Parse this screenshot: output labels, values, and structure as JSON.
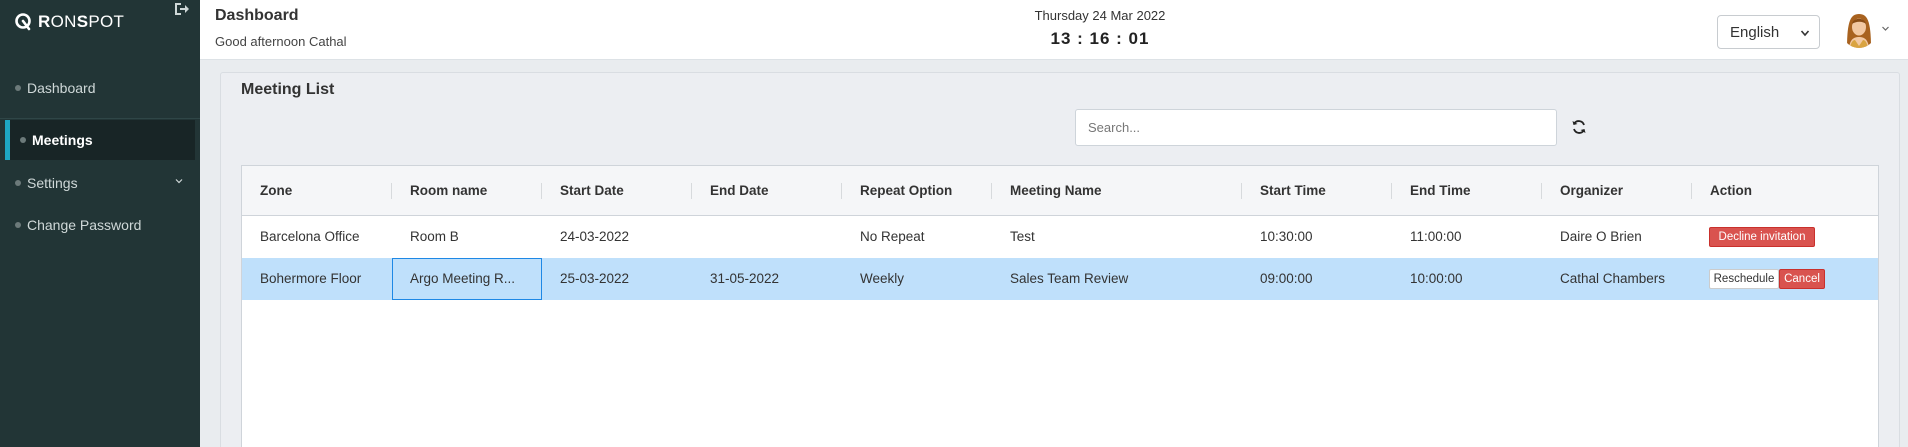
{
  "sidebar": {
    "logo": {
      "prefix": "R",
      "mid1": "ON",
      "mid2": "S",
      "rest": "POT"
    },
    "items": [
      {
        "label": "Dashboard"
      },
      {
        "label": "Meetings",
        "active": true
      },
      {
        "label": "Settings",
        "has_submenu": true
      },
      {
        "label": "Change Password"
      }
    ],
    "icons": [
      "logout-icon",
      "chevron-down-icon"
    ]
  },
  "header": {
    "title": "Dashboard",
    "greeting": "Good afternoon Cathal",
    "date": "Thursday 24 Mar 2022",
    "clock": "13 : 16 : 01",
    "language": "English"
  },
  "main": {
    "title": "Meeting List",
    "search_placeholder": "Search...",
    "table": {
      "columns": [
        "Zone",
        "Room name",
        "Start Date",
        "End Date",
        "Repeat Option",
        "Meeting Name",
        "Start Time",
        "End Time",
        "Organizer",
        "Action"
      ],
      "rows": [
        {
          "zone": "Barcelona Office",
          "room": "Room B",
          "start_date": "24-03-2022",
          "end_date": "",
          "repeat": "No Repeat",
          "meeting_name": "Test",
          "start_time": "10:30:00",
          "end_time": "11:00:00",
          "organizer": "Daire O Brien",
          "actions": [
            "Decline invitation"
          ]
        },
        {
          "zone": "Bohermore Floor",
          "room": "Argo Meeting R...",
          "start_date": "25-03-2022",
          "end_date": "31-05-2022",
          "repeat": "Weekly",
          "meeting_name": "Sales Team Review",
          "start_time": "09:00:00",
          "end_time": "10:00:00",
          "organizer": "Cathal Chambers",
          "actions": [
            "Reschedule",
            "Cancel"
          ],
          "selected": true
        }
      ]
    }
  },
  "colors": {
    "sidebar_bg": "#223536",
    "active_accent": "#1ea7c4",
    "selected_row": "#bfe0fb",
    "danger": "#d9534f"
  }
}
